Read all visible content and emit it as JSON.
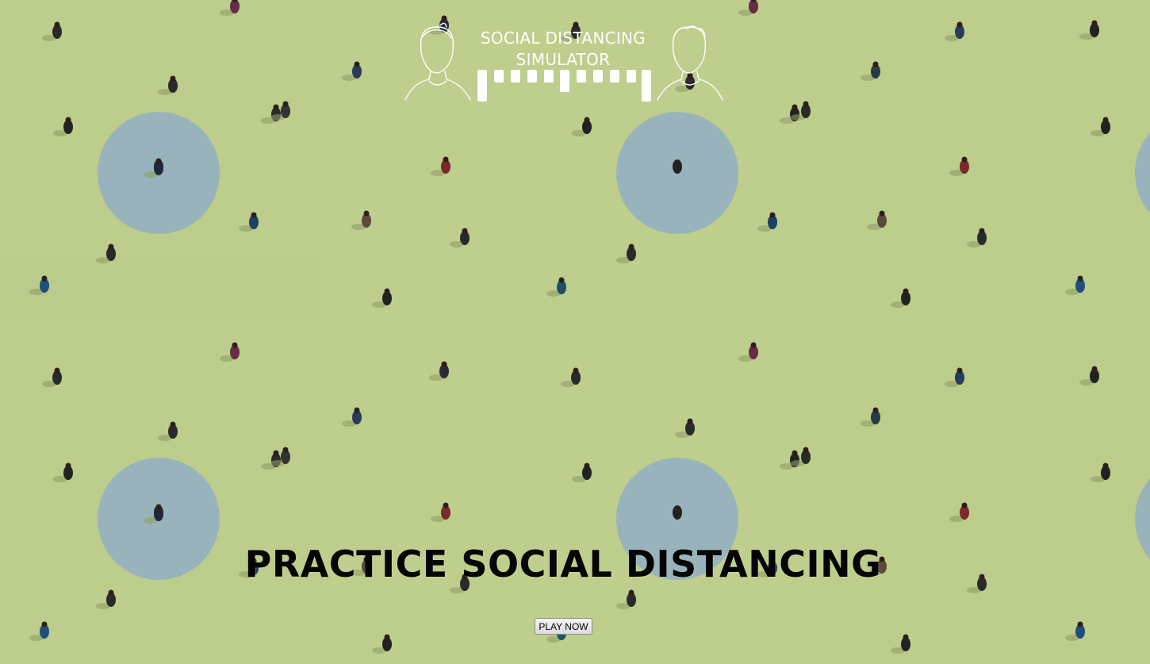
{
  "logo": {
    "title_line1": "SOCIAL DISTANCING",
    "title_line2": "SIMULATOR",
    "icon": "two-faces-distance-ruler-icon"
  },
  "headline": "PRACTICE SOCIAL DISTANCING",
  "play_button": "PLAY NOW",
  "colors": {
    "grass": "#bccd8c",
    "circle": "#98b3bb",
    "headline": "#050505",
    "logo": "#ffffff"
  }
}
